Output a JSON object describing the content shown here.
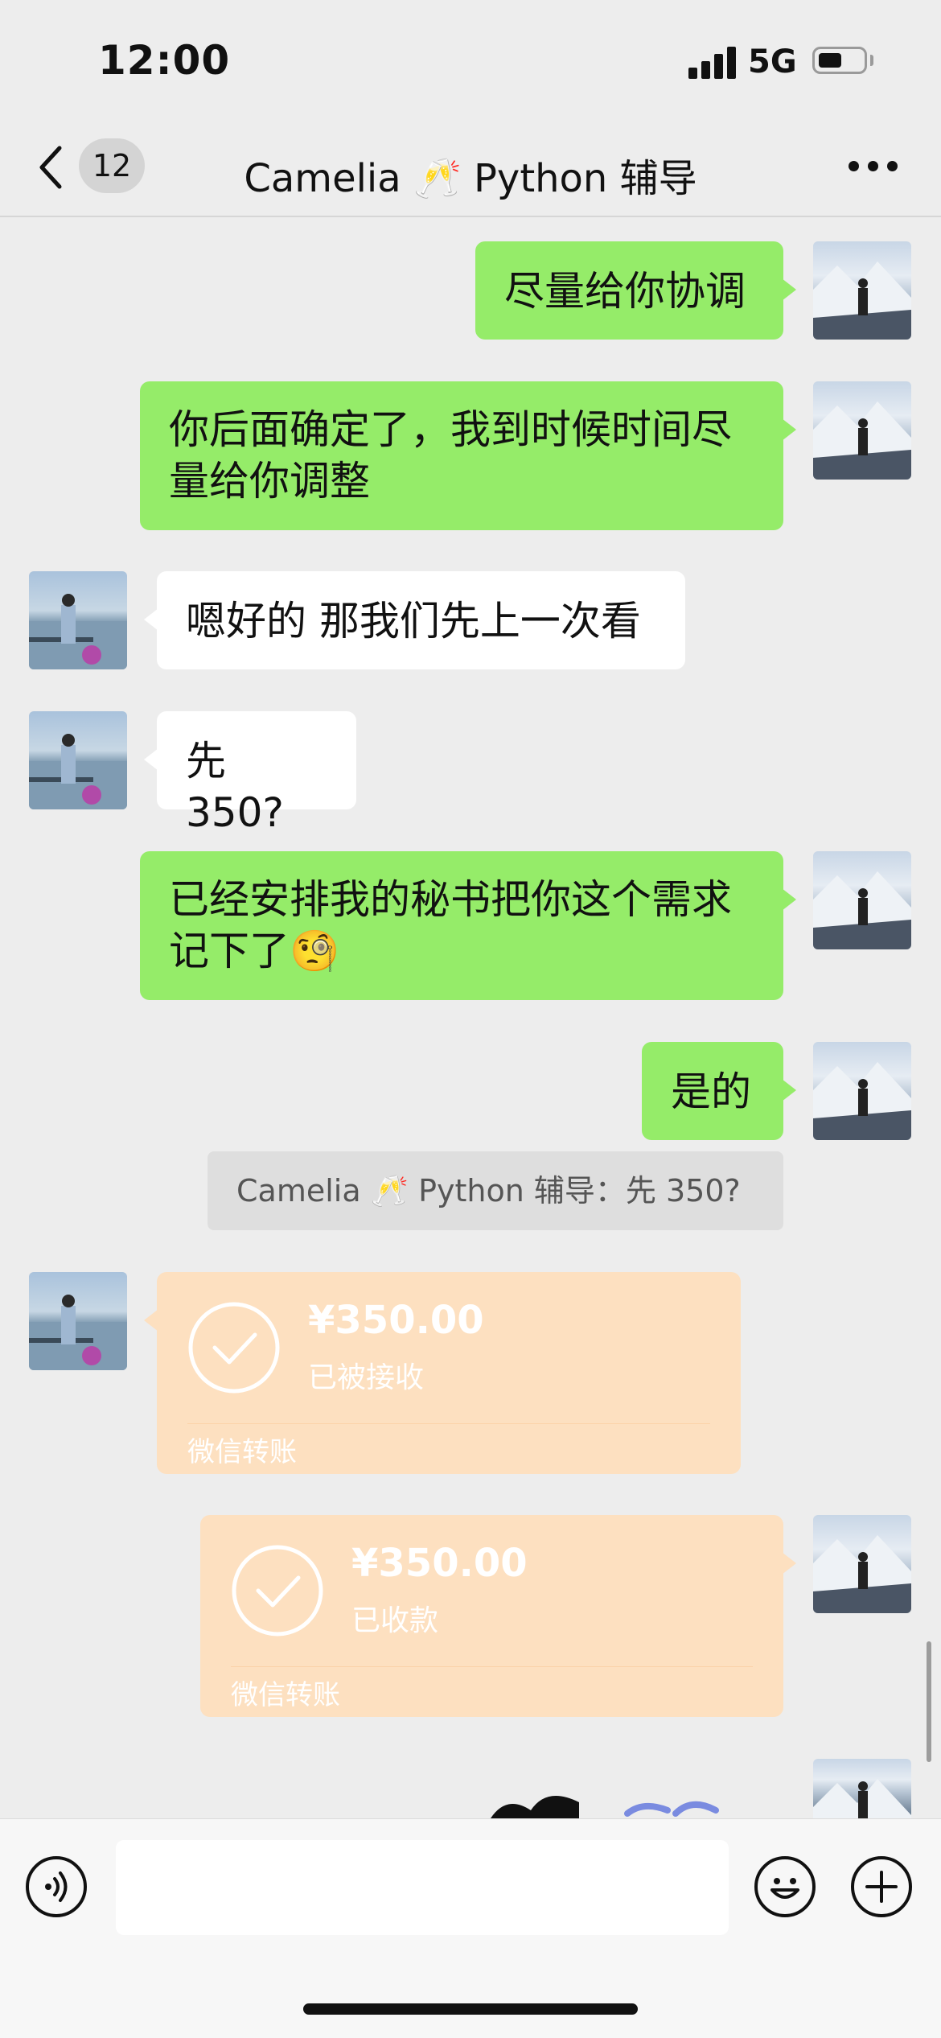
{
  "status_bar": {
    "time": "12:00",
    "network": "5G"
  },
  "nav": {
    "unread_count": "12",
    "title": "Camelia 🥂 Python 辅导"
  },
  "messages": [
    {
      "text": "尽量给你协调"
    },
    {
      "text_line1": "你后面确定了，我到时候时间尽",
      "text_line2": "量给你调整"
    },
    {
      "text": "嗯好的 那我们先上一次看"
    },
    {
      "text": "先 350?"
    },
    {
      "text_line1": "已经安排我的秘书把你这个需求",
      "text_line2": "记下了🧐"
    },
    {
      "text": "是的"
    }
  ],
  "quote": {
    "text": "Camelia 🥂 Python 辅导：先 350?"
  },
  "transfers": [
    {
      "amount": "¥350.00",
      "status": "已被接收",
      "footer": "微信转账"
    },
    {
      "amount": "¥350.00",
      "status": "已收款",
      "footer": "微信转账"
    }
  ],
  "colors": {
    "my_bubble": "#95ec69",
    "their_bubble": "#ffffff",
    "transfer": "#fde0c0",
    "background": "#ededed"
  }
}
